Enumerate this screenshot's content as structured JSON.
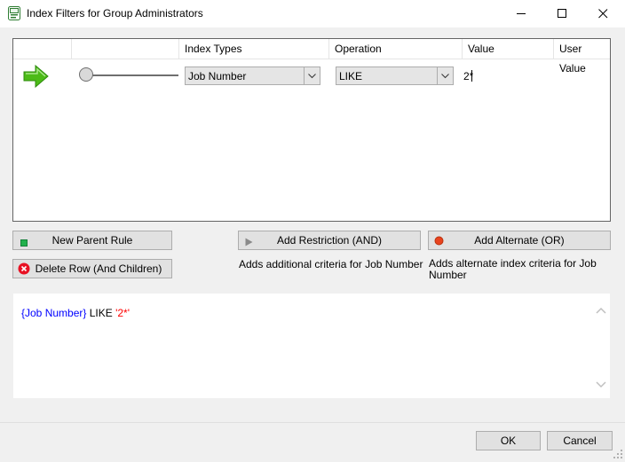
{
  "window": {
    "title": "Index Filters for Group Administrators",
    "minimize_icon": "minimize-icon",
    "maximize_icon": "maximize-icon",
    "close_icon": "close-icon"
  },
  "grid": {
    "columns": [
      "",
      "",
      "Index Types",
      "Operation",
      "Value",
      "User Value"
    ],
    "row": {
      "indicator_icon": "green-arrow-icon",
      "index_type": "Job Number",
      "operation": "LIKE",
      "value": "2*"
    }
  },
  "actions": {
    "new_parent_rule": "New Parent Rule",
    "delete_row": "Delete Row (And Children)",
    "add_restriction": "Add Restriction (AND)",
    "add_alternate": "Add Alternate (OR)",
    "add_restriction_desc": "Adds additional criteria for Job Number",
    "add_alternate_desc_line1": "Adds alternate index criteria for Job",
    "add_alternate_desc_line2": "Number"
  },
  "expression": {
    "field": "{Job Number}",
    "operator": " LIKE ",
    "value": "'2*'"
  },
  "footer": {
    "ok": "OK",
    "cancel": "Cancel"
  },
  "colors": {
    "field_blue": "#0000ff",
    "value_red": "#ff0000",
    "arrow_green": "#4cbb17",
    "new_rule_green": "#22b14c",
    "delete_red": "#e81123"
  }
}
